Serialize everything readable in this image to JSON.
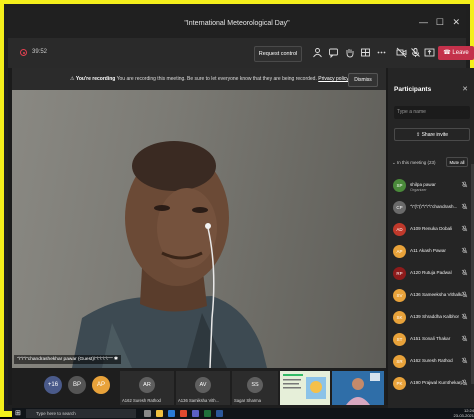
{
  "window": {
    "title": "\"International Meteorological Day\"",
    "minimize": "—",
    "maximize": "☐",
    "close": "✕"
  },
  "toolbar": {
    "elapsed": "39:52",
    "request_control": "Request control",
    "leave": "Leave",
    "leave_color": "#c4314b"
  },
  "recording_banner": {
    "bold": "You're recording",
    "message": "You are recording this meeting. Be sure to let everyone know that they are being recorded.",
    "link": "Privacy policy",
    "dismiss": "Dismiss"
  },
  "video": {
    "nameplate": "\"\\\"\\\"\\\"chandrashekhar pawar (Guest)\\\"\\\"\\\"\\\"\\\"\"\"",
    "wall_color": "#7b7a74"
  },
  "strip": {
    "overflow": "+16",
    "avatars": [
      "BP",
      "AP"
    ],
    "tiles": [
      {
        "initials": "AR",
        "name": "A162 Suresh Rathod"
      },
      {
        "initials": "AV",
        "name": "A136 Samiksha Vith..."
      },
      {
        "initials": "SS",
        "name": "Sagar Sharma"
      }
    ]
  },
  "panel": {
    "title": "Participants",
    "search_placeholder": "Type a name",
    "share_invite": "Share invite",
    "section": "In this meeting (23)",
    "mute_all": "Mute all",
    "participants": [
      {
        "initials": "SP",
        "name": "shilpa pawar",
        "role": "Organizer",
        "color": "#4a8a3a"
      },
      {
        "initials": "CP",
        "name": "\"\\\"(\\\"(\\\"\\\"\\\"\\\"chandrash...",
        "role": "",
        "color": "#6a6a6a"
      },
      {
        "initials": "AD",
        "name": "A109 Renuka Dobali",
        "role": "",
        "color": "#c0392b"
      },
      {
        "initials": "AP",
        "name": "A11 Akash Pawar",
        "role": "",
        "color": "#e8a23a"
      },
      {
        "initials": "RP",
        "name": "A120 Rutuja Padwal",
        "role": "",
        "color": "#8e1b1b"
      },
      {
        "initials": "SV",
        "name": "A136 Sameeksha Vithalkar",
        "role": "",
        "color": "#e8a23a"
      },
      {
        "initials": "SK",
        "name": "A139 Shraddha Kalbhor",
        "role": "",
        "color": "#e8a23a"
      },
      {
        "initials": "ST",
        "name": "A151 Sonali Thakar",
        "role": "",
        "color": "#e8a23a"
      },
      {
        "initials": "SR",
        "name": "A162 Suresh Rathod",
        "role": "",
        "color": "#e8a23a"
      },
      {
        "initials": "PK",
        "name": "A190 Prajwal Kumthekarpatil",
        "role": "",
        "color": "#e8a23a"
      }
    ]
  },
  "taskbar": {
    "search": "Type here to search",
    "time": "12:24",
    "date": "23-03-2021"
  }
}
